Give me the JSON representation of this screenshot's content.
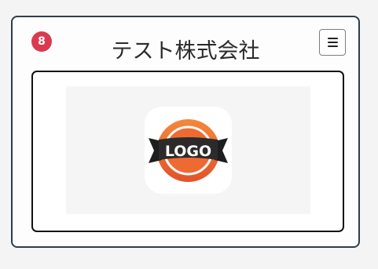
{
  "header": {
    "badge_count": "8",
    "title": "テスト株式会社",
    "menu_icon": "hamburger-menu-icon"
  },
  "logo": {
    "text": "LOGO",
    "icon": "logo-app-icon",
    "colors": {
      "orange_light": "#f5873a",
      "orange_dark": "#e55a2b",
      "ribbon": "#2b2b2b",
      "text": "#ffffff"
    }
  }
}
